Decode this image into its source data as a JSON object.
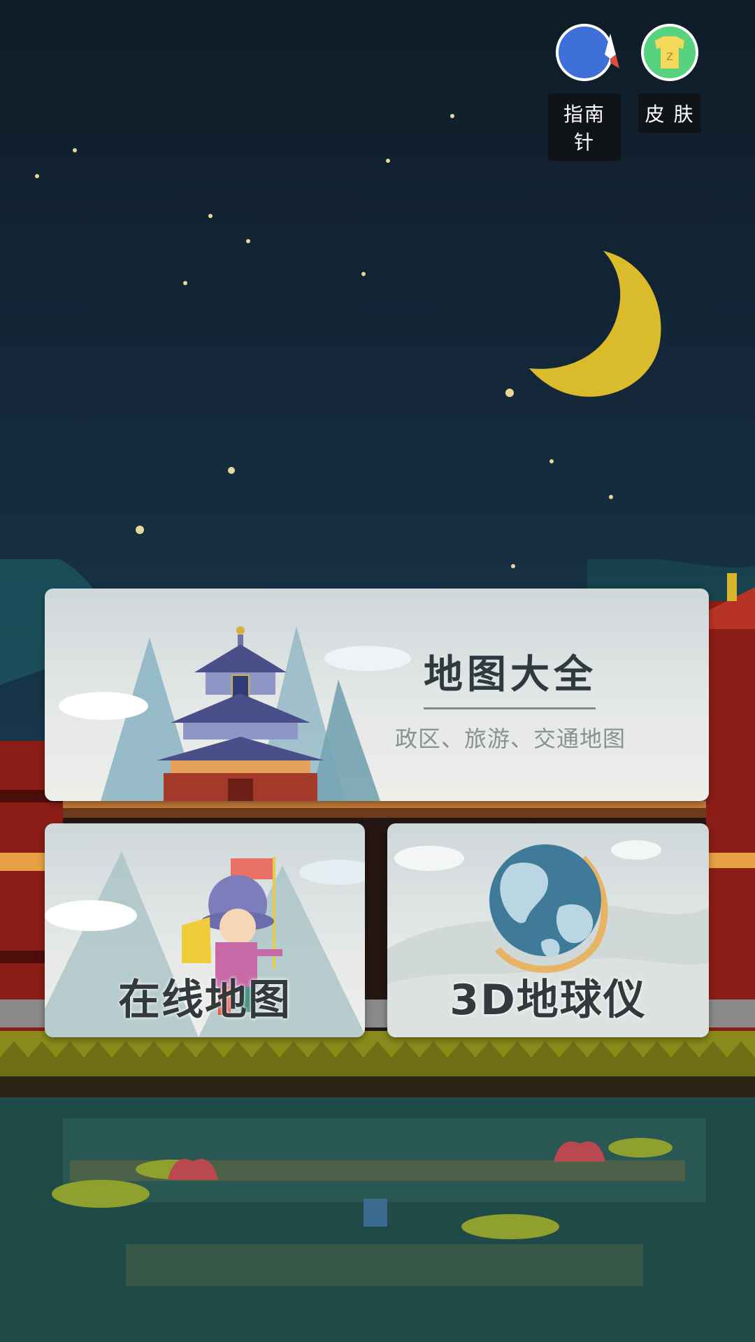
{
  "top_actions": {
    "compass": {
      "label": "指南针",
      "icon": "compass-icon"
    },
    "skin": {
      "label": "皮 肤",
      "icon": "tshirt-skin-icon"
    }
  },
  "cards": {
    "atlas": {
      "title": "地图大全",
      "subtitle": "政区、旅游、交通地图"
    },
    "online_map": {
      "title": "在线地图"
    },
    "globe": {
      "title": "3D地球仪"
    }
  },
  "colors": {
    "sky_top": "#0f1c27",
    "moon": "#e0c02a",
    "compass_bg": "#3f6fd8",
    "skin_bg": "#57d27f"
  }
}
